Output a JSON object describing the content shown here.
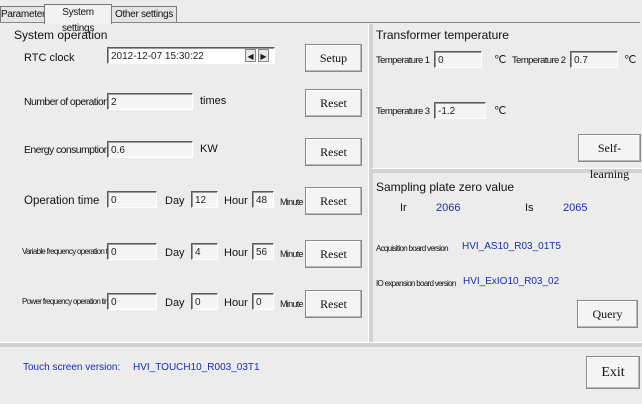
{
  "tabs": [
    {
      "label": "Parameters"
    },
    {
      "label": "System settings"
    },
    {
      "label": "Other settings"
    }
  ],
  "system_operation": {
    "title": "System operation",
    "rtc": {
      "label": "RTC clock",
      "value": "2012-12-07 15:30:22",
      "button": "Setup"
    },
    "operations": {
      "label": "Number of operations",
      "value": "2",
      "unit": "times",
      "button": "Reset"
    },
    "energy": {
      "label": "Energy consumption",
      "value": "0.6",
      "unit": "KW",
      "button": "Reset"
    },
    "operation_time": {
      "label": "Operation time",
      "day": "0",
      "hour": "12",
      "minute": "48",
      "button": "Reset"
    },
    "vf_time": {
      "label": "Variable frequency operation time",
      "day": "0",
      "hour": "4",
      "minute": "56",
      "button": "Reset"
    },
    "pf_time": {
      "label": "Power frequency operation time",
      "day": "0",
      "hour": "0",
      "minute": "0",
      "button": "Reset"
    },
    "units": {
      "day": "Day",
      "hour": "Hour",
      "minute": "Minute"
    }
  },
  "transformer": {
    "title": "Transformer temperature",
    "t1": {
      "label": "Temperature 1",
      "value": "0"
    },
    "t2": {
      "label": "Temperature 2",
      "value": "0.7"
    },
    "t3": {
      "label": "Temperature 3",
      "value": "-1.2"
    },
    "unit": "℃",
    "button": "Self-learning"
  },
  "sampling": {
    "title": "Sampling plate zero value",
    "ir_label": "Ir",
    "ir_value": "2066",
    "is_label": "Is",
    "is_value": "2065",
    "acq_label": "Acquisition board version",
    "acq_value": "HVI_AS10_R03_01T5",
    "io_label": "IO expansion board version",
    "io_value": "HVI_ExIO10_R03_02",
    "button": "Query"
  },
  "footer": {
    "label": "Touch screen version:",
    "value": "HVI_TOUCH10_R003_03T1",
    "exit": "Exit"
  },
  "colors": {
    "value_blue": "#1a2bb5",
    "background": "#ececec"
  }
}
